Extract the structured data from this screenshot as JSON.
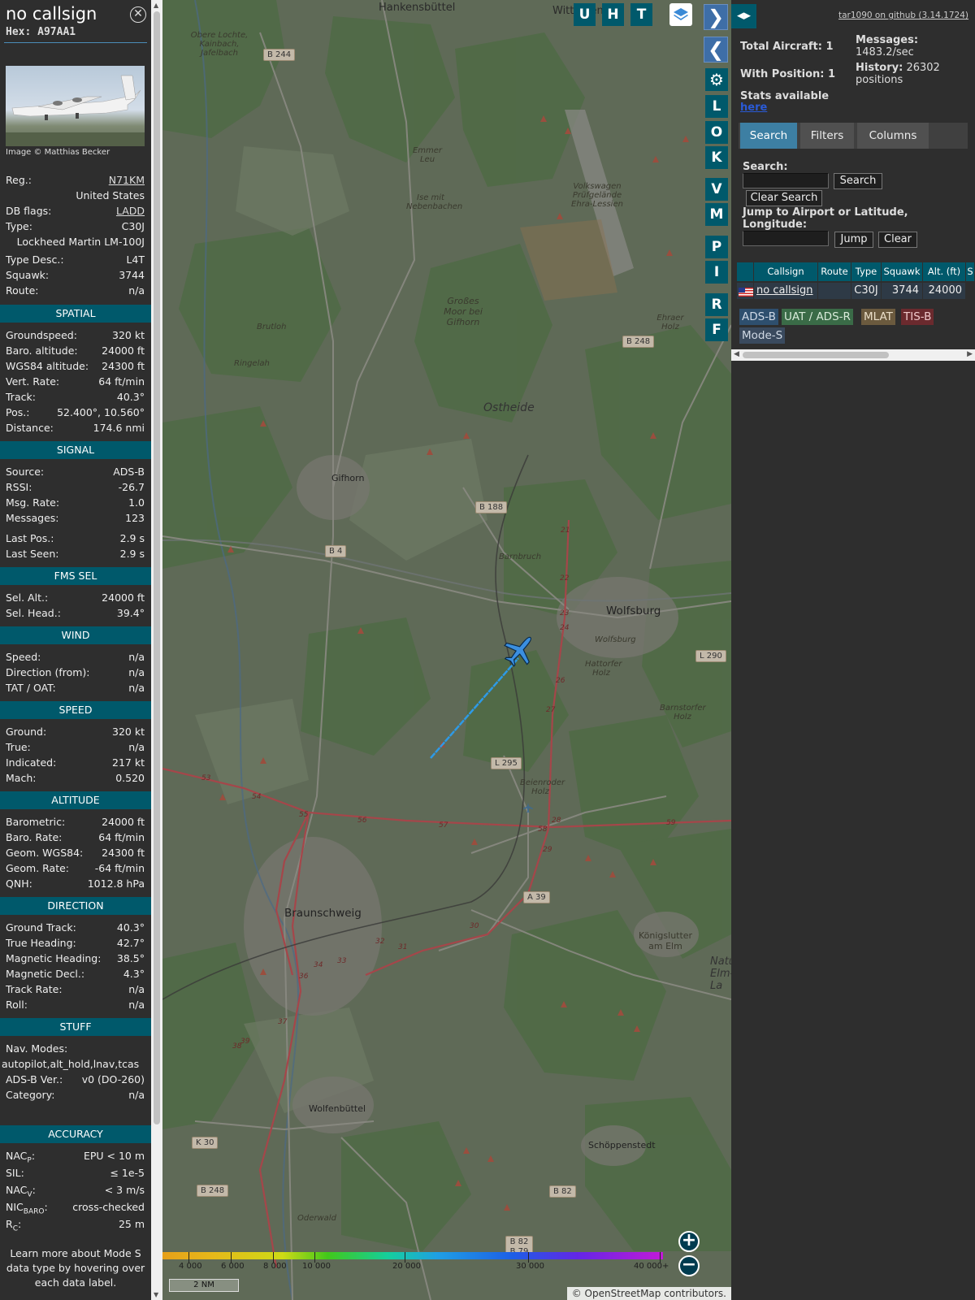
{
  "aircraft": {
    "callsign": "no callsign",
    "hex": "Hex: A97AA1",
    "image_credit": "Image © Matthias Becker",
    "reg_label": "Reg.:",
    "reg": "N71KM",
    "country": "United States",
    "dbflags_label": "DB flags:",
    "dbflags": "LADD",
    "type_label": "Type:",
    "type": "C30J",
    "type_full": "Lockheed Martin LM-100J",
    "typedesc_label": "Type Desc.:",
    "typedesc": "L4T",
    "squawk_label": "Squawk:",
    "squawk": "3744",
    "route_label": "Route:",
    "route": "n/a"
  },
  "sections": {
    "spatial": "SPATIAL",
    "signal": "SIGNAL",
    "fms": "FMS SEL",
    "wind": "WIND",
    "speed": "SPEED",
    "altitude": "ALTITUDE",
    "direction": "DIRECTION",
    "stuff": "STUFF",
    "accuracy": "ACCURACY"
  },
  "spatial": [
    {
      "k": "Groundspeed:",
      "v": "320 kt"
    },
    {
      "k": "Baro. altitude:",
      "v": "24000 ft"
    },
    {
      "k": "WGS84 altitude:",
      "v": "24300 ft"
    },
    {
      "k": "Vert. Rate:",
      "v": "64 ft/min"
    },
    {
      "k": "Track:",
      "v": "40.3°"
    },
    {
      "k": "Pos.:",
      "v": "52.400°, 10.560°"
    },
    {
      "k": "Distance:",
      "v": "174.6 nmi"
    }
  ],
  "signal": [
    {
      "k": "Source:",
      "v": "ADS-B"
    },
    {
      "k": "RSSI:",
      "v": "-26.7"
    },
    {
      "k": "Msg. Rate:",
      "v": "1.0"
    },
    {
      "k": "Messages:",
      "v": "123"
    },
    {
      "k": "Last Pos.:",
      "v": "2.9 s"
    },
    {
      "k": "Last Seen:",
      "v": "2.9 s"
    }
  ],
  "fms": [
    {
      "k": "Sel. Alt.:",
      "v": "24000 ft"
    },
    {
      "k": "Sel. Head.:",
      "v": "39.4°"
    }
  ],
  "wind": [
    {
      "k": "Speed:",
      "v": "n/a"
    },
    {
      "k": "Direction (from):",
      "v": "n/a"
    },
    {
      "k": "TAT / OAT:",
      "v": "n/a"
    }
  ],
  "speed": [
    {
      "k": "Ground:",
      "v": "320 kt"
    },
    {
      "k": "True:",
      "v": "n/a"
    },
    {
      "k": "Indicated:",
      "v": "217 kt"
    },
    {
      "k": "Mach:",
      "v": "0.520"
    }
  ],
  "altitude": [
    {
      "k": "Barometric:",
      "v": "24000 ft"
    },
    {
      "k": "Baro. Rate:",
      "v": "64 ft/min"
    },
    {
      "k": "Geom. WGS84:",
      "v": "24300 ft"
    },
    {
      "k": "Geom. Rate:",
      "v": "-64 ft/min"
    },
    {
      "k": "QNH:",
      "v": "1012.8 hPa"
    }
  ],
  "direction": [
    {
      "k": "Ground Track:",
      "v": "40.3°"
    },
    {
      "k": "True Heading:",
      "v": "42.7°"
    },
    {
      "k": "Magnetic Heading:",
      "v": "38.5°"
    },
    {
      "k": "Magnetic Decl.:",
      "v": "4.3°"
    },
    {
      "k": "Track Rate:",
      "v": "n/a"
    },
    {
      "k": "Roll:",
      "v": "n/a"
    }
  ],
  "stuff": {
    "navmodes_label": "Nav. Modes:",
    "navmodes": "autopilot,alt_hold,lnav,tcas",
    "adsbver_label": "ADS-B Ver.:",
    "adsbver": "v0 (DO-260)",
    "category_label": "Category:",
    "category": "n/a"
  },
  "accuracy": [
    {
      "k": "NAC",
      "sub": "P",
      "v": "EPU < 10 m"
    },
    {
      "k": "SIL:",
      "sub": "",
      "v": "≤ 1e-5"
    },
    {
      "k": "NAC",
      "sub": "V",
      "v": "< 3 m/s"
    },
    {
      "k": "NIC",
      "sub": "BARO",
      "v": "cross-checked"
    },
    {
      "k": "R",
      "sub": "C",
      "v": "25 m"
    }
  ],
  "learn_more": "Learn more about Mode S data type by hovering over each data label.",
  "map": {
    "buttons": [
      "U",
      "H",
      "T"
    ],
    "side_buttons": [
      "L",
      "O",
      "K",
      "V",
      "M",
      "P",
      "I",
      "R",
      "F"
    ],
    "towns": {
      "hankensbuttel": "Hankensbüttel",
      "wittingen": "Wittingen",
      "gifhorn": "Gifhorn",
      "wolfsburg": "Wolfsburg",
      "braunschweig": "Braunschweig",
      "wolfenbuttel": "Wolfenbüttel",
      "konigslutter": "Königslutter am Elm",
      "schoppenstedt": "Schöppenstedt",
      "ostheide": "Ostheide",
      "grosses_moor": "Großes Moor bei Gifhorn",
      "natur_elm": "Natur Elm-La",
      "emmer": "Emmer Leu",
      "isenmit": "Ise mit Nebenbachen",
      "vw": "Volkswagen Prüfgelände Ehra-Lessien",
      "obere_lochte": "Obere Lochte, Kainbach, Jafelbach",
      "brutloh": "Brutloh",
      "ringelah": "Ringelah",
      "barnbruch": "Barnbruch",
      "hattorfer": "Hattorfer Holz",
      "barnstorfer": "Barnstorfer Holz",
      "beienroder": "Beienroder Holz",
      "ehraer": "Ehraer Holz",
      "wolfsburg2": "Wolfsburg",
      "oderwald": "Oderwald"
    },
    "roads": {
      "b244": "B 244",
      "b248a": "B 248",
      "b188": "B 188",
      "b4": "B 4",
      "l290": "L 290",
      "l295": "L 295",
      "a39": "A 39",
      "k30": "K 30",
      "b248b": "B 248",
      "b82a": "B 82",
      "b82b": "B 82 B 79"
    },
    "colorbar_labels": [
      "4 000",
      "6 000",
      "8 000",
      "10 000",
      "20 000",
      "30 000",
      "40 000+"
    ],
    "scale": "2 NM",
    "attribution": "© OpenStreetMap contributors."
  },
  "right": {
    "github": "tar1090 on github (3.14.1724)",
    "total_aircraft": "Total Aircraft: 1",
    "with_position": "With Position: 1",
    "messages_label": "Messages:",
    "messages_rate": "1483.2/sec",
    "history_label": "History:",
    "history_count": "26302",
    "history_unit": "positions",
    "stats_label": "Stats available",
    "stats_link": "here",
    "tabs": [
      "Search",
      "Filters",
      "Columns"
    ],
    "search_label": "Search:",
    "search_button": "Search",
    "clear_search_button": "Clear Search",
    "jump_label": "Jump to Airport or Latitude, Longitude:",
    "jump_button": "Jump",
    "clear_button": "Clear",
    "table_headers": [
      "",
      "Callsign",
      "Route",
      "Type",
      "Squawk",
      "Alt. (ft)",
      "S"
    ],
    "table_row": {
      "callsign": "no callsign",
      "route": "",
      "type": "C30J",
      "squawk": "3744",
      "alt": "24000"
    },
    "legend": [
      {
        "label": "ADS-B",
        "color": "#2e4f6e",
        "text": "#cfd9e6"
      },
      {
        "label": "UAT / ADS-R",
        "color": "#3a6b47",
        "text": "#d8ead9"
      },
      {
        "label": "MLAT",
        "color": "#6b5a3e",
        "text": "#eadfc9"
      },
      {
        "label": "TIS-B",
        "color": "#6b2a2e",
        "text": "#f0c9cb"
      },
      {
        "label": "Mode-S",
        "color": "#3a4a5e",
        "text": "#d0d9e4"
      }
    ]
  }
}
